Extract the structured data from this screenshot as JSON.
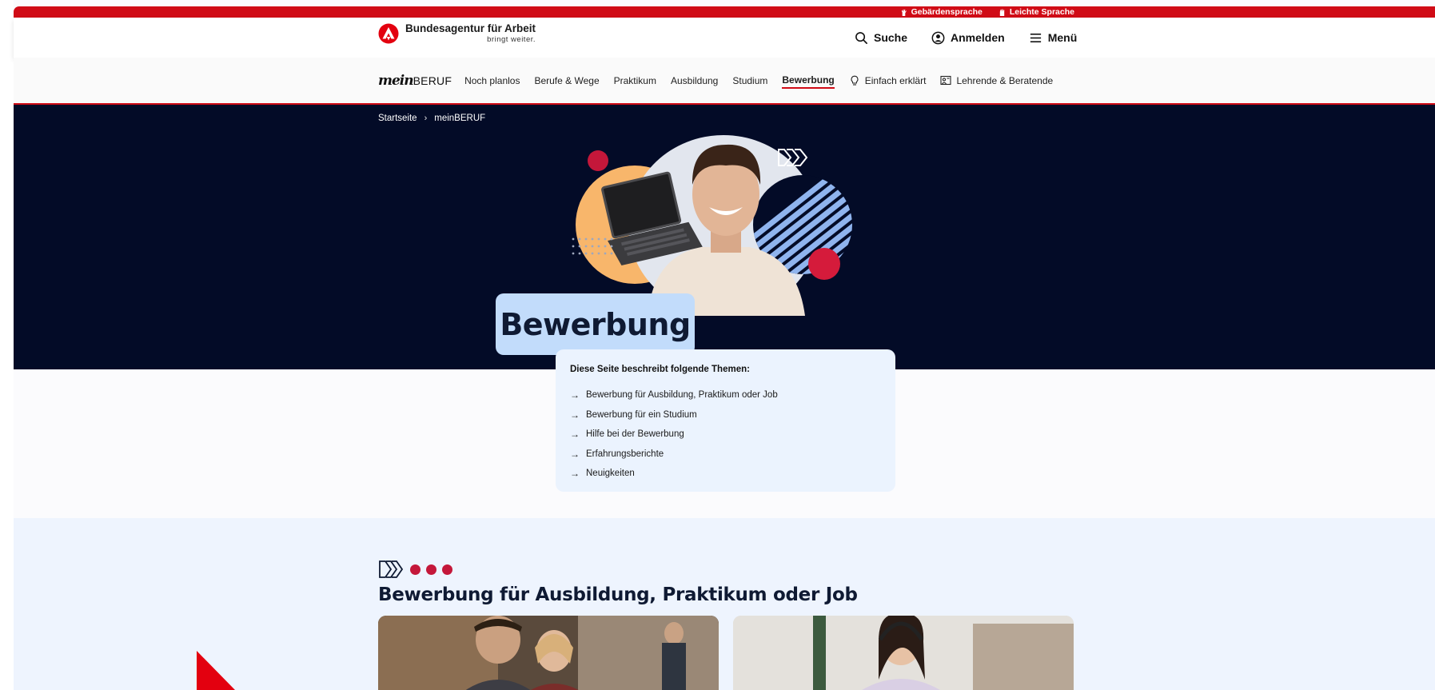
{
  "topbar": {
    "links": [
      "Gebärdensprache",
      "Leichte Sprache"
    ]
  },
  "header": {
    "logo_title": "Bundesagentur für Arbeit",
    "logo_tagline": "bringt weiter.",
    "nav": {
      "search": "Suche",
      "login": "Anmelden",
      "menu": "Menü"
    }
  },
  "subnav": {
    "brand_mein": "mein",
    "brand_beruf": "BERUF",
    "items": [
      "Noch planlos",
      "Berufe & Wege",
      "Praktikum",
      "Ausbildung",
      "Studium",
      "Bewerbung",
      "Einfach erklärt",
      "Lehrende & Beratende"
    ],
    "active": "Bewerbung"
  },
  "breadcrumb": [
    "Startseite",
    "meinBERUF"
  ],
  "hero": {
    "title": "Bewerbung"
  },
  "toc": {
    "heading": "Diese Seite beschreibt folgende Themen:",
    "items": [
      "Bewerbung für Ausbildung, Praktikum oder Job",
      "Bewerbung für ein Studium",
      "Hilfe bei der Bewerbung",
      "Erfahrungsberichte",
      "Neuigkeiten"
    ]
  },
  "section": {
    "heading": "Bewerbung für Ausbildung, Praktikum oder Job"
  },
  "colors": {
    "brand_red": "#d00b16",
    "hero_bg": "#030b27",
    "title_card": "#c2dcfb",
    "toc_bg": "#ebf3fe",
    "accent_dot": "#c4173a"
  }
}
